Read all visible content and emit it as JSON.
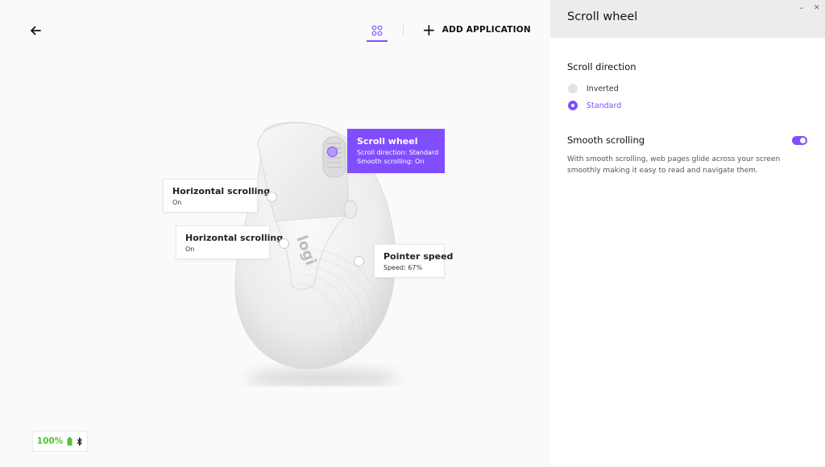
{
  "header": {
    "back_icon": "arrow-left-icon",
    "view_tab_icon": "buttons-grid-icon",
    "add_application_label": "ADD APPLICATION",
    "accent_color": "#814eff"
  },
  "callouts": {
    "scroll_wheel": {
      "title": "Scroll wheel",
      "line1": "Scroll direction: Standard",
      "line2": "Smooth scrolling: On"
    },
    "hscroll_1": {
      "title": "Horizontal scrolling",
      "value": "On"
    },
    "hscroll_2": {
      "title": "Horizontal scrolling",
      "value": "On"
    },
    "pointer_speed": {
      "title": "Pointer speed",
      "value": "Speed: 67%"
    }
  },
  "mouse": {
    "logo_text": "logi"
  },
  "battery": {
    "level": "100%",
    "battery_icon": "battery-full-icon",
    "connection_icon": "bluetooth-icon",
    "status_color": "#52c234"
  },
  "panel": {
    "title": "Scroll wheel",
    "minimize_glyph": "–",
    "close_glyph": "✕",
    "scroll_direction": {
      "title": "Scroll direction",
      "options": [
        "Inverted",
        "Standard"
      ],
      "selected": "Standard"
    },
    "smooth_scrolling": {
      "title": "Smooth scrolling",
      "enabled": true,
      "description": "With smooth scrolling, web pages glide across your screen smoothly making it easy to read and navigate them."
    }
  }
}
